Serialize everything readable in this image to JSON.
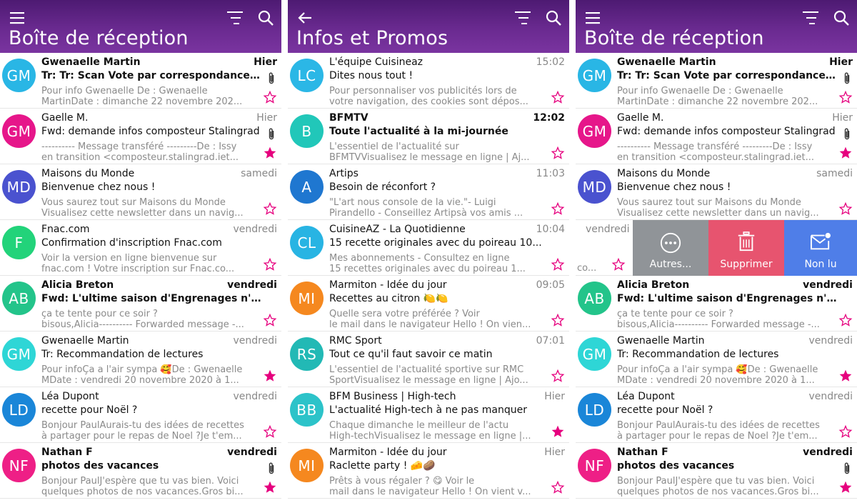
{
  "colors": {
    "header_top": "#4d1a72",
    "header_bottom": "#7a34a0",
    "star": "#e6007e",
    "swipe_more": "#909498",
    "swipe_delete": "#e7546f",
    "swipe_unread": "#4f7ee8"
  },
  "icons": {
    "menu": "hamburger-icon",
    "back": "arrow-left-icon",
    "sort": "sort-icon",
    "search": "search-icon",
    "attachment": "paperclip-icon",
    "star": "star-icon",
    "more": "more-circle-icon",
    "delete": "trash-icon",
    "unread": "mail-unread-icon"
  },
  "panels": [
    {
      "title": "Boîte de réception",
      "left_icon": "menu",
      "emails": [
        {
          "initials": "GM",
          "color": "#29b6e5",
          "sender": "Gwenaelle Martin",
          "date": "Hier",
          "subject": "Tr: Tr: Scan Vote par correspondance ...",
          "preview1": "Pour info Gwenaelle De : Gwenaelle",
          "preview2": "MartinDate : dimanche 22 novembre 202...",
          "unread": true,
          "attachment": true,
          "starred": false
        },
        {
          "initials": "GM",
          "color": "#e6168a",
          "sender": "Gaelle M.",
          "date": "Hier",
          "subject": "Fwd: demande infos composteur Stalingrad",
          "preview1": "---------- Message transféré ---------De : Issy",
          "preview2": "en transition <composteur.stalingrad.iet...",
          "unread": false,
          "attachment": true,
          "starred": true
        },
        {
          "initials": "MD",
          "color": "#4a52cf",
          "sender": "Maisons du Monde",
          "date": "samedi",
          "subject": "Bienvenue chez nous !",
          "preview1": "Vous saurez tout sur Maisons du Monde",
          "preview2": "Visualisez cette newsletter dans un navig...",
          "unread": false,
          "attachment": false,
          "starred": false
        },
        {
          "initials": "F",
          "color": "#22d37a",
          "sender": "Fnac.com",
          "date": "vendredi",
          "subject": "Confirmation d'inscription Fnac.com",
          "preview1": "Voir la version en ligne bienvenue sur",
          "preview2": "fnac.com ! Votre inscription sur Fnac.co...",
          "unread": false,
          "attachment": false,
          "starred": false
        },
        {
          "initials": "AB",
          "color": "#23c48a",
          "sender": "Alicia Breton",
          "date": "vendredi",
          "subject": "Fwd: L'ultime saison d'Engrenages n'a...",
          "preview1": "ça te tente pour ce soir ?",
          "preview2": "bisous,Alicia---------- Forwarded message -...",
          "unread": true,
          "attachment": false,
          "starred": false
        },
        {
          "initials": "GM",
          "color": "#2ed6d6",
          "sender": "Gwenaelle Martin",
          "date": "vendredi",
          "subject": "Tr: Recommandation de lectures",
          "preview1": "Pour infoÇa a l'air sympa 🥰De : Gwenaelle",
          "preview2": "MDate : vendredi 20 novembre 2020 à 1...",
          "unread": false,
          "attachment": false,
          "starred": true
        },
        {
          "initials": "LD",
          "color": "#1a86d8",
          "sender": "Léa Dupont",
          "date": "vendredi",
          "subject": "recette pour Noël ?",
          "preview1": "Bonjour PaulAurais-tu des idées de recettes",
          "preview2": "à partager pour le repas de Noel ?Je t'em...",
          "unread": false,
          "attachment": false,
          "starred": false
        },
        {
          "initials": "NF",
          "color": "#ee1f86",
          "sender": "Nathan F",
          "date": "vendredi",
          "subject": "photos des vacances",
          "preview1": "Bonjour PaulJ'espère que tu vas bien. Voici",
          "preview2": "quelques photos de nos vacances.Gros bi...",
          "unread": true,
          "attachment": true,
          "starred": true
        }
      ]
    },
    {
      "title": "Infos et Promos",
      "left_icon": "back",
      "emails": [
        {
          "initials": "LC",
          "color": "#2bb7e6",
          "sender": "L'équipe Cuisineaz",
          "date": "15:02",
          "subject": "Dites nous tout !",
          "preview1": "Pour personnaliser vos publicités lors de",
          "preview2": "votre navigation, des cookies sont dépos...",
          "unread": false,
          "attachment": false,
          "starred": false
        },
        {
          "initials": "B",
          "color": "#21c7b9",
          "sender": "BFMTV",
          "date": "12:02",
          "subject": "Toute l'actualité à la mi-journée",
          "preview1": "L'essentiel de l'actualité sur",
          "preview2": "BFMTVVisualisez le message en ligne | Aj...",
          "unread": true,
          "attachment": false,
          "starred": false
        },
        {
          "initials": "A",
          "color": "#1f77d0",
          "sender": "Artips",
          "date": "11:03",
          "subject": "Besoin de réconfort ?",
          "preview1": "\"L'art nous console de la vie.\"- Luigi",
          "preview2": "Pirandello - Conseillez Artipsà vos amis ...",
          "unread": false,
          "attachment": false,
          "starred": false
        },
        {
          "initials": "CL",
          "color": "#28b4e3",
          "sender": "CuisineAZ - La Quotidienne",
          "date": "10:04",
          "subject": "15 recette originales avec du poireau 10...",
          "preview1": "Mes abonnements - Consultez en ligne",
          "preview2": "15 recettes originales avec du poireau 1...",
          "unread": false,
          "attachment": false,
          "starred": false
        },
        {
          "initials": "MI",
          "color": "#f5881f",
          "sender": "Marmiton - Idée du jour",
          "date": "09:05",
          "subject": "Recettes au citron 🍋🍋",
          "preview1": "Quelle sera votre préférée ?          Voir",
          "preview2": "le mail dans le navigateur Hello ! On vien...",
          "unread": false,
          "attachment": false,
          "starred": false
        },
        {
          "initials": "RS",
          "color": "#22b9b5",
          "sender": "RMC Sport",
          "date": "07:01",
          "subject": "Tout ce qu'il faut savoir ce matin",
          "preview1": "L'essentiel de l'actualité sportive sur RMC",
          "preview2": "SportVisualisez le message en ligne | Ajo...",
          "unread": false,
          "attachment": false,
          "starred": false
        },
        {
          "initials": "BB",
          "color": "#2cc3c9",
          "sender": "BFM Business | High-tech",
          "date": "Hier",
          "subject": "L'actualité High-tech à ne pas manquer",
          "preview1": "Chaque dimanche le meilleur de l'actu",
          "preview2": "High-techVisualisez le message en ligne |...",
          "unread": false,
          "attachment": false,
          "starred": true
        },
        {
          "initials": "MI",
          "color": "#f5881f",
          "sender": "Marmiton - Idée du jour",
          "date": "Hier",
          "subject": "Raclette party ! 🧀🥔",
          "preview1": "Prêts à vous régaler ? 😋          Voir le",
          "preview2": "mail dans le navigateur Hello ! On vient v...",
          "unread": false,
          "attachment": false,
          "starred": false
        }
      ]
    },
    {
      "title": "Boîte de réception",
      "left_icon": "menu",
      "swipe_index": 3,
      "swipe": {
        "date": "vendredi",
        "truncated": "co...",
        "more": "Autres...",
        "delete": "Supprimer",
        "unread": "Non lu"
      },
      "emails": [
        {
          "initials": "GM",
          "color": "#29b6e5",
          "sender": "Gwenaelle Martin",
          "date": "Hier",
          "subject": "Tr: Tr: Scan Vote par correspondance ...",
          "preview1": "Pour info Gwenaelle De : Gwenaelle",
          "preview2": "MartinDate : dimanche 22 novembre 202...",
          "unread": true,
          "attachment": true,
          "starred": false
        },
        {
          "initials": "GM",
          "color": "#e6168a",
          "sender": "Gaelle M.",
          "date": "Hier",
          "subject": "Fwd: demande infos composteur Stalingrad",
          "preview1": "---------- Message transféré ---------De : Issy",
          "preview2": "en transition <composteur.stalingrad.iet...",
          "unread": false,
          "attachment": true,
          "starred": true
        },
        {
          "initials": "MD",
          "color": "#4a52cf",
          "sender": "Maisons du Monde",
          "date": "samedi",
          "subject": "Bienvenue chez nous !",
          "preview1": "Vous saurez tout sur Maisons du Monde",
          "preview2": "Visualisez cette newsletter dans un navig...",
          "unread": false,
          "attachment": false,
          "starred": false
        },
        {
          "initials": "",
          "color": "#ffffff",
          "sender": "",
          "date": "",
          "subject": "",
          "preview1": "",
          "preview2": "",
          "unread": false,
          "attachment": false,
          "starred": false
        },
        {
          "initials": "AB",
          "color": "#23c48a",
          "sender": "Alicia Breton",
          "date": "vendredi",
          "subject": "Fwd: L'ultime saison d'Engrenages n'a...",
          "preview1": "ça te tente pour ce soir ?",
          "preview2": "bisous,Alicia---------- Forwarded message -...",
          "unread": true,
          "attachment": false,
          "starred": false
        },
        {
          "initials": "GM",
          "color": "#2ed6d6",
          "sender": "Gwenaelle Martin",
          "date": "vendredi",
          "subject": "Tr: Recommandation de lectures",
          "preview1": "Pour infoÇa a l'air sympa 🥰De : Gwenaelle",
          "preview2": "MDate : vendredi 20 novembre 2020 à 1...",
          "unread": false,
          "attachment": false,
          "starred": true
        },
        {
          "initials": "LD",
          "color": "#1a86d8",
          "sender": "Léa Dupont",
          "date": "vendredi",
          "subject": "recette pour Noël ?",
          "preview1": "Bonjour PaulAurais-tu des idées de recettes",
          "preview2": "à partager pour le repas de Noel ?Je t'em...",
          "unread": false,
          "attachment": false,
          "starred": false
        },
        {
          "initials": "NF",
          "color": "#ee1f86",
          "sender": "Nathan F",
          "date": "vendredi",
          "subject": "photos des vacances",
          "preview1": "Bonjour PaulJ'espère que tu vas bien. Voici",
          "preview2": "quelques photos de nos vacances.Gros bi...",
          "unread": true,
          "attachment": true,
          "starred": true
        }
      ]
    }
  ]
}
